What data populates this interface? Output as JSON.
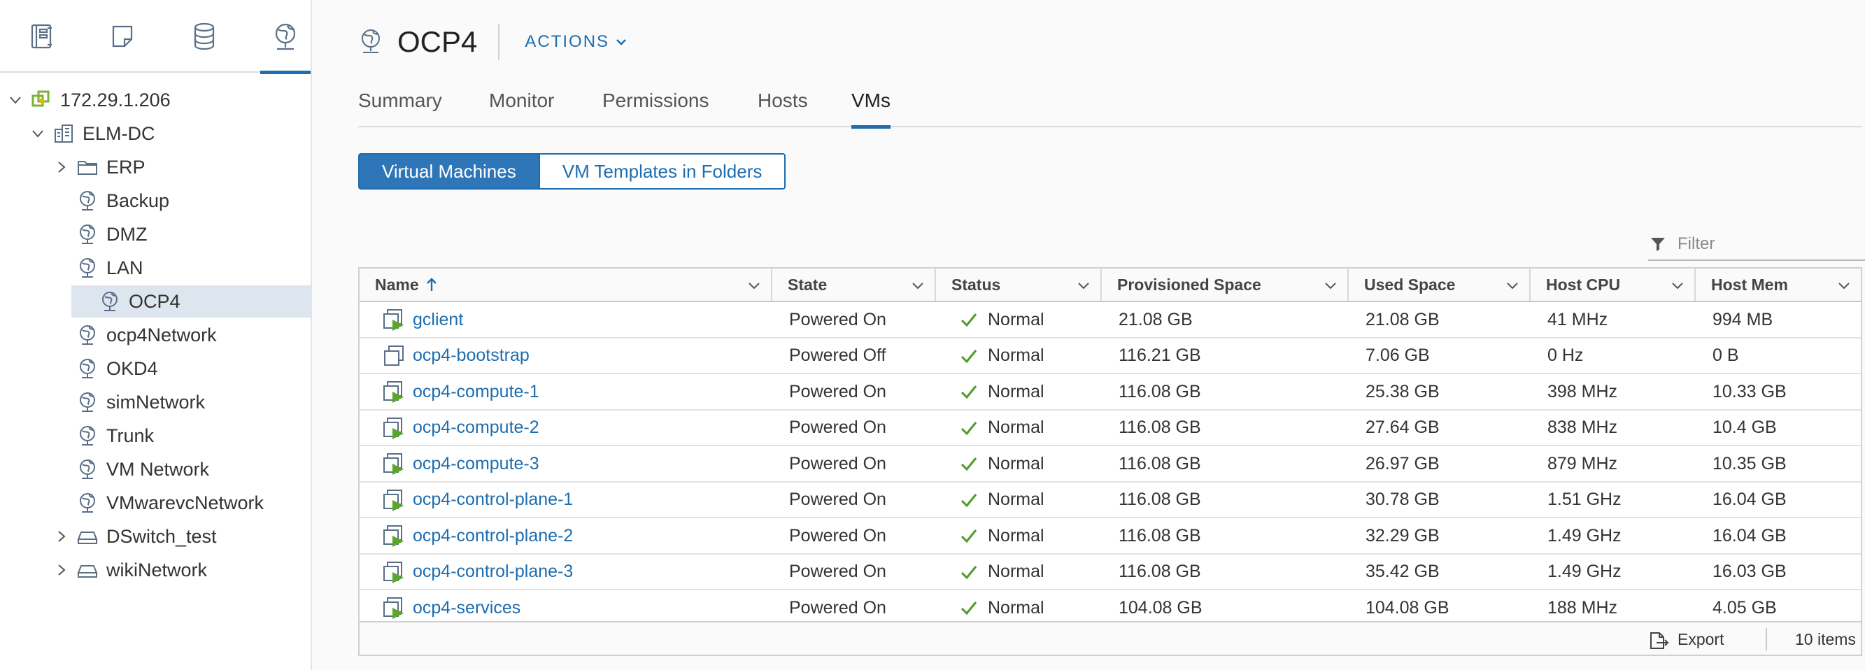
{
  "nav": {
    "icons": [
      "hosts-clusters-icon",
      "vms-templates-icon",
      "storage-icon",
      "networking-icon"
    ],
    "active_icon": "networking-icon",
    "tree": [
      {
        "label": "172.29.1.206",
        "icon": "vcenter-icon",
        "caret": "down"
      },
      {
        "label": "ELM-DC",
        "icon": "datacenter-icon",
        "caret": "down"
      },
      {
        "label": "ERP",
        "icon": "folder-icon",
        "caret": "right"
      },
      {
        "label": "Backup",
        "icon": "network-icon",
        "caret": ""
      },
      {
        "label": "DMZ",
        "icon": "network-icon",
        "caret": ""
      },
      {
        "label": "LAN",
        "icon": "network-icon",
        "caret": ""
      },
      {
        "label": "OCP4",
        "icon": "network-icon",
        "caret": "",
        "selected": true
      },
      {
        "label": "ocp4Network",
        "icon": "network-icon",
        "caret": ""
      },
      {
        "label": "OKD4",
        "icon": "network-icon",
        "caret": ""
      },
      {
        "label": "simNetwork",
        "icon": "network-icon",
        "caret": ""
      },
      {
        "label": "Trunk",
        "icon": "network-icon",
        "caret": ""
      },
      {
        "label": "VM Network",
        "icon": "network-icon",
        "caret": ""
      },
      {
        "label": "VMwarevcNetwork",
        "icon": "network-icon",
        "caret": ""
      },
      {
        "label": "DSwitch_test",
        "icon": "dswitch-icon",
        "caret": "right"
      },
      {
        "label": "wikiNetwork",
        "icon": "dswitch-icon",
        "caret": "right"
      }
    ]
  },
  "header": {
    "title": "OCP4",
    "actions_label": "ACTIONS"
  },
  "tabs": [
    {
      "label": "Summary"
    },
    {
      "label": "Monitor"
    },
    {
      "label": "Permissions"
    },
    {
      "label": "Hosts"
    },
    {
      "label": "VMs",
      "active": true
    }
  ],
  "segments": {
    "active": "Virtual Machines",
    "other": "VM Templates in Folders"
  },
  "filter": {
    "placeholder": "Filter"
  },
  "table": {
    "columns": [
      "Name",
      "State",
      "Status",
      "Provisioned Space",
      "Used Space",
      "Host CPU",
      "Host Mem"
    ],
    "sort": {
      "column": "Name",
      "direction": "ascending"
    },
    "rows": [
      {
        "name": "gclient",
        "state": "Powered On",
        "status": "Normal",
        "prov": "21.08 GB",
        "used": "21.08 GB",
        "cpu": "41 MHz",
        "mem": "994 MB",
        "powered": true
      },
      {
        "name": "ocp4-bootstrap",
        "state": "Powered Off",
        "status": "Normal",
        "prov": "116.21 GB",
        "used": "7.06 GB",
        "cpu": "0 Hz",
        "mem": "0 B",
        "powered": false
      },
      {
        "name": "ocp4-compute-1",
        "state": "Powered On",
        "status": "Normal",
        "prov": "116.08 GB",
        "used": "25.38 GB",
        "cpu": "398 MHz",
        "mem": "10.33 GB",
        "powered": true
      },
      {
        "name": "ocp4-compute-2",
        "state": "Powered On",
        "status": "Normal",
        "prov": "116.08 GB",
        "used": "27.64 GB",
        "cpu": "838 MHz",
        "mem": "10.4 GB",
        "powered": true
      },
      {
        "name": "ocp4-compute-3",
        "state": "Powered On",
        "status": "Normal",
        "prov": "116.08 GB",
        "used": "26.97 GB",
        "cpu": "879 MHz",
        "mem": "10.35 GB",
        "powered": true
      },
      {
        "name": "ocp4-control-plane-1",
        "state": "Powered On",
        "status": "Normal",
        "prov": "116.08 GB",
        "used": "30.78 GB",
        "cpu": "1.51 GHz",
        "mem": "16.04 GB",
        "powered": true
      },
      {
        "name": "ocp4-control-plane-2",
        "state": "Powered On",
        "status": "Normal",
        "prov": "116.08 GB",
        "used": "32.29 GB",
        "cpu": "1.49 GHz",
        "mem": "16.04 GB",
        "powered": true
      },
      {
        "name": "ocp4-control-plane-3",
        "state": "Powered On",
        "status": "Normal",
        "prov": "116.08 GB",
        "used": "35.42 GB",
        "cpu": "1.49 GHz",
        "mem": "16.03 GB",
        "powered": true
      },
      {
        "name": "ocp4-services",
        "state": "Powered On",
        "status": "Normal",
        "prov": "104.08 GB",
        "used": "104.08 GB",
        "cpu": "188 MHz",
        "mem": "4.05 GB",
        "powered": true
      }
    ]
  },
  "footer": {
    "export_label": "Export",
    "count_label": "10 items"
  },
  "colors": {
    "accent": "#1d6db0",
    "selected_row": "#dde5ee",
    "status_ok": "#4f9a2a"
  }
}
